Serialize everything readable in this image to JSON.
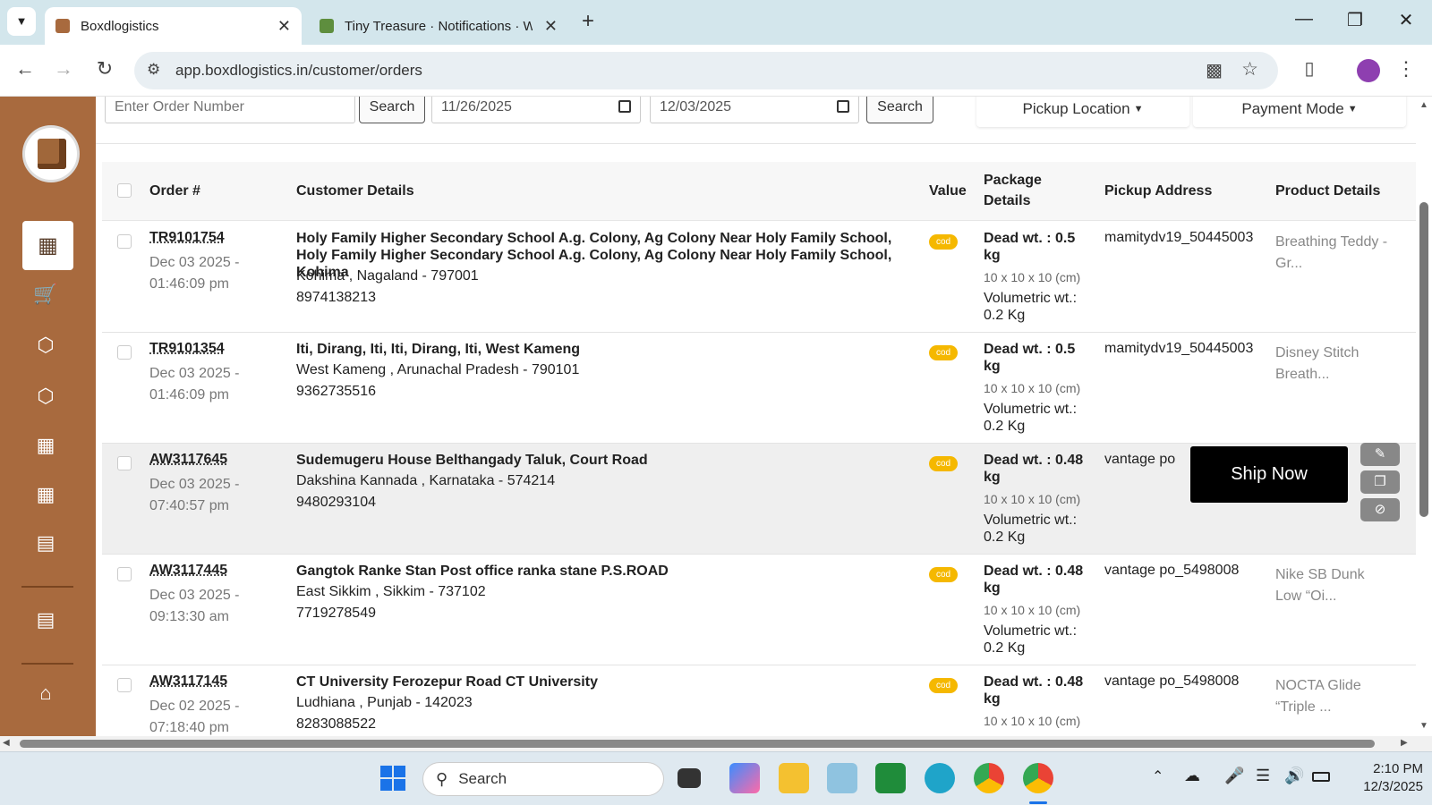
{
  "browser": {
    "tabs": [
      {
        "title": "Boxdlogistics",
        "active": true
      },
      {
        "title": "Tiny Treasure · Notifications · W",
        "active": false
      }
    ],
    "url": "app.boxdlogistics.in/customer/orders"
  },
  "filters": {
    "order_placeholder": "Enter Order Number",
    "search_label": "Search",
    "date_from": "11/26/2025",
    "date_to": "12/03/2025",
    "search2_label": "Search",
    "pickup_location_label": "Pickup Location",
    "payment_mode_label": "Payment Mode"
  },
  "table": {
    "headers": {
      "order": "Order #",
      "customer": "Customer Details",
      "value": "Value",
      "package": "Package Details",
      "pickup": "Pickup Address",
      "product": "Product Details"
    },
    "rows": [
      {
        "order_no": "TR9101754",
        "date": "Dec 03 2025 - 01:46:09 pm",
        "address": "Holy Family Higher Secondary School A.g. Colony, Ag Colony Near Holy Family School, Holy Family Higher Secondary School A.g. Colony, Ag Colony Near Holy Family School, Kohima",
        "city": "Kohima , Nagaland - 797001",
        "phone": "8974138213",
        "value_badge": "cod",
        "dead_wt": "Dead wt. : 0.5 kg",
        "dims": "10 x 10 x 10 (cm)",
        "vol_wt": "Volumetric wt.: 0.2 Kg",
        "pickup": "mamitydv19_50445003",
        "product": "Breathing Teddy - Gr..."
      },
      {
        "order_no": "TR9101354",
        "date": "Dec 03 2025 - 01:46:09 pm",
        "address": "Iti, Dirang, Iti, Iti, Dirang, Iti, West Kameng",
        "city": "West Kameng , Arunachal Pradesh - 790101",
        "phone": "9362735516",
        "value_badge": "cod",
        "dead_wt": "Dead wt. : 0.5 kg",
        "dims": "10 x 10 x 10 (cm)",
        "vol_wt": "Volumetric wt.: 0.2 Kg",
        "pickup": "mamitydv19_50445003",
        "product": "Disney Stitch Breath..."
      },
      {
        "order_no": "AW3117645",
        "date": "Dec 03 2025 - 07:40:57 pm",
        "address": "Sudemugeru House Belthangady Taluk, Court Road",
        "city": "Dakshina Kannada , Karnataka - 574214",
        "phone": "9480293104",
        "value_badge": "cod",
        "dead_wt": "Dead wt. : 0.48 kg",
        "dims": "10 x 10 x 10 (cm)",
        "vol_wt": "Volumetric wt.: 0.2 Kg",
        "pickup": "vantage po",
        "product": ""
      },
      {
        "order_no": "AW3117445",
        "date": "Dec 03 2025 - 09:13:30 am",
        "address": "Gangtok Ranke Stan Post office ranka stane P.S.ROAD",
        "city": "East Sikkim , Sikkim - 737102",
        "phone": "7719278549",
        "value_badge": "cod",
        "dead_wt": "Dead wt. : 0.48 kg",
        "dims": "10 x 10 x 10 (cm)",
        "vol_wt": "Volumetric wt.: 0.2 Kg",
        "pickup": "vantage po_5498008",
        "product": "Nike SB Dunk Low “Oi..."
      },
      {
        "order_no": "AW3117145",
        "date": "Dec 02 2025 - 07:18:40 pm",
        "address": "CT University Ferozepur Road CT University",
        "city": "Ludhiana , Punjab - 142023",
        "phone": "8283088522",
        "value_badge": "cod",
        "dead_wt": "Dead wt. : 0.48 kg",
        "dims": "10 x 10 x 10 (cm)",
        "vol_wt": "",
        "pickup": "vantage po_5498008",
        "product": "NOCTA Glide “Triple ..."
      }
    ]
  },
  "ship_now_label": "Ship Now",
  "taskbar": {
    "search_label": "Search",
    "time": "2:10 PM",
    "date": "12/3/2025"
  },
  "colors": {
    "sidebar": "#a86a3e",
    "cod_badge": "#f5b800",
    "tabbar": "#d3e6ec"
  }
}
